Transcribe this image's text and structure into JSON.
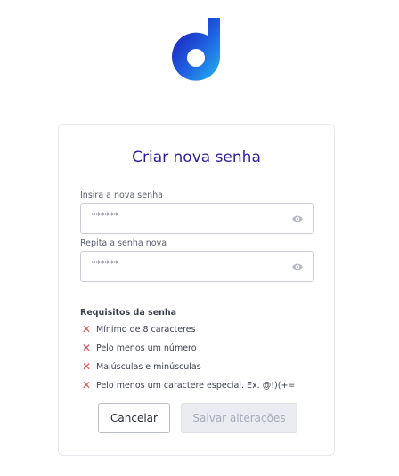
{
  "brand": {
    "logo_icon": "brand-logo-d",
    "gradient_start": "#1f1fb8",
    "gradient_end": "#1fa9f0"
  },
  "card": {
    "title": "Criar nova senha",
    "new_password": {
      "label": "Insira a nova senha",
      "value": "******",
      "toggle_icon": "eye-icon"
    },
    "repeat_password": {
      "label": "Repita a senha nova",
      "value": "******",
      "toggle_icon": "eye-icon"
    },
    "requirements": {
      "title": "Requisitos da senha",
      "items": [
        "Mínimo de 8 caracteres",
        "Pelo menos um número",
        "Maiúsculas e minúsculas",
        "Pelo menos um caractere especial. Ex. @!)(+="
      ],
      "status_icon": "x-icon",
      "status_color": "#e04b4b"
    },
    "buttons": {
      "cancel": "Cancelar",
      "save": "Salvar alterações"
    },
    "accent_color": "#2f1f9c"
  }
}
